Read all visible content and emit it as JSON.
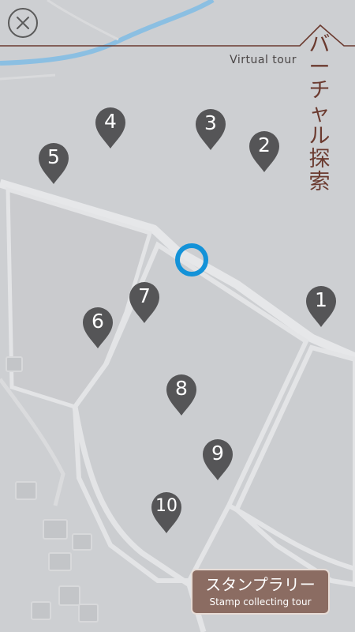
{
  "header": {
    "close_icon": "close-x-icon",
    "subtitle_en": "Virtual tour",
    "title_jp": [
      "バ",
      "ー",
      "チ",
      "ャ",
      "ル",
      "探",
      "索"
    ],
    "title_color": "#6b3a2f"
  },
  "map": {
    "background_color": "#cdcfd2",
    "road_color": "#e6e7e9",
    "river_color": "#8bbfe2",
    "spots": [
      {
        "label": "1"
      },
      {
        "label": "2"
      },
      {
        "label": "3"
      },
      {
        "label": "4"
      },
      {
        "label": "5"
      },
      {
        "label": "6"
      },
      {
        "label": "7"
      },
      {
        "label": "8"
      },
      {
        "label": "9"
      },
      {
        "label": "10"
      }
    ],
    "pin_color": "#555557",
    "current_location_icon": "current-location-ring-icon",
    "location_color": "#1392d8"
  },
  "stamp_button": {
    "label_jp": "スタンプラリー",
    "label_en": "Stamp collecting tour",
    "color": "#8b6c62"
  }
}
